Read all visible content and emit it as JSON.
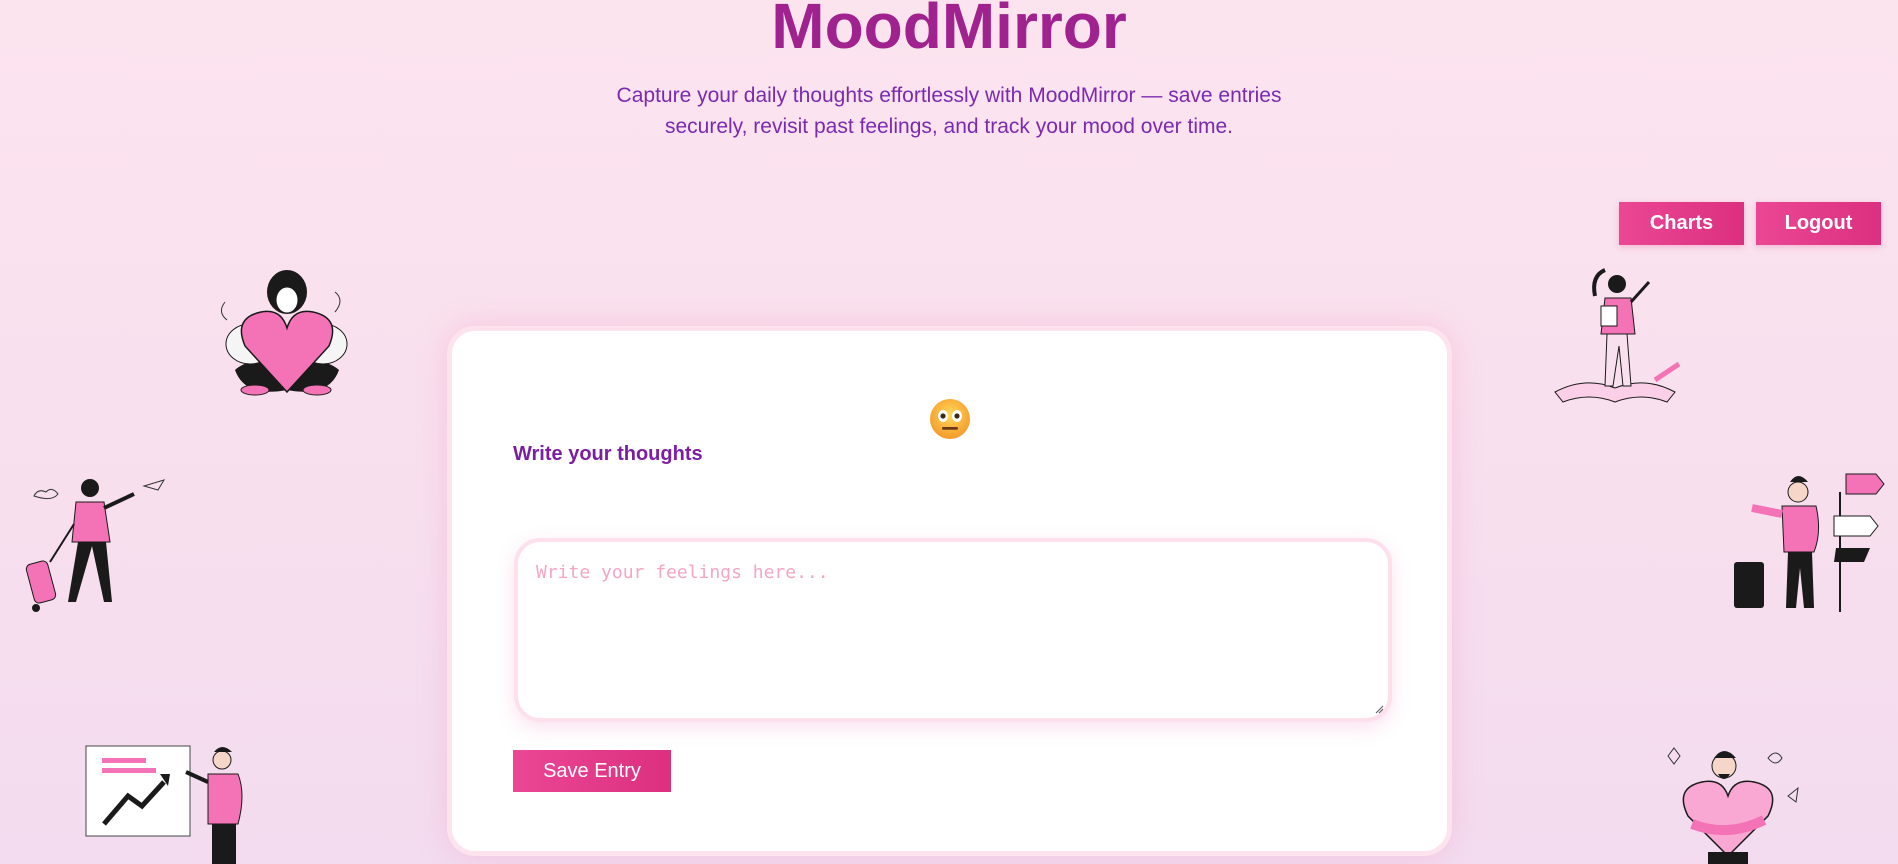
{
  "header": {
    "title": "MoodMirror",
    "subtitle": "Capture your daily thoughts effortlessly with MoodMirror — save entries securely, revisit past feelings, and track your mood over time."
  },
  "nav": {
    "charts_label": "Charts",
    "logout_label": "Logout"
  },
  "editor": {
    "mood_emoji": "neutral-face-icon",
    "label": "Write your thoughts",
    "textarea_value": "",
    "textarea_placeholder": "Write your feelings here...",
    "save_label": "Save Entry"
  },
  "colors": {
    "title": "#a0228f",
    "subtitle": "#7b2ab0",
    "accent": "#e0337f",
    "illustration_pink": "#f472b6"
  },
  "illustrations": [
    "woman-hugging-heart-illustration",
    "traveler-with-suitcase-illustration",
    "presenter-with-chart-illustration",
    "girl-on-book-illustration",
    "man-with-signpost-illustration",
    "man-hugging-heart-illustration"
  ]
}
